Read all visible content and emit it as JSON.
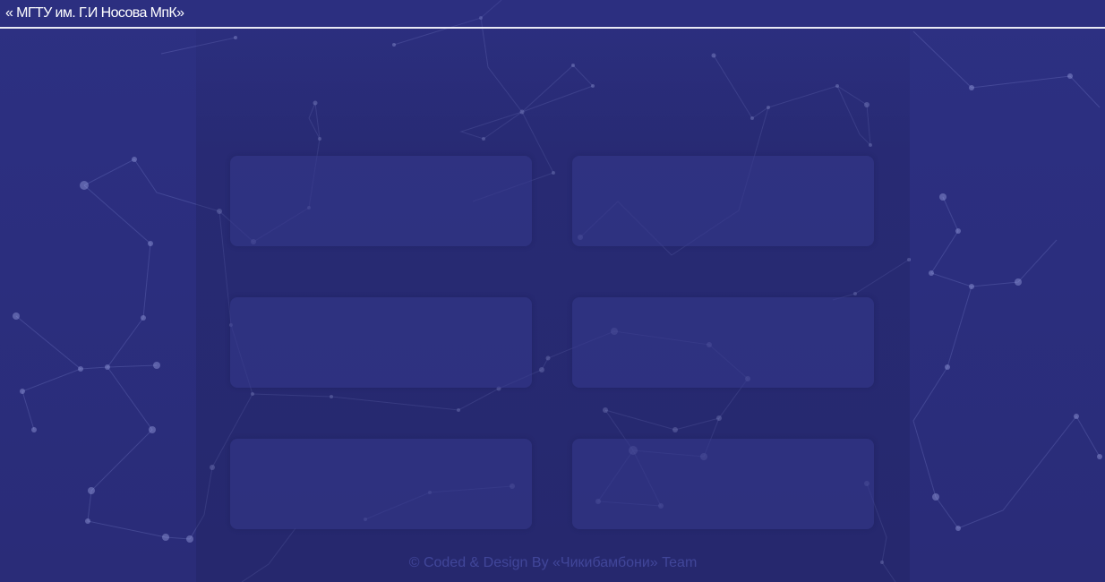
{
  "header": {
    "site_title": "« МГТУ им. Г.И Носова МпК»"
  },
  "main": {
    "cards": [
      {
        "label": ""
      },
      {
        "label": ""
      },
      {
        "label": ""
      },
      {
        "label": ""
      },
      {
        "label": ""
      },
      {
        "label": ""
      }
    ]
  },
  "footer": {
    "text": "© Coded & Design By «Чикибамбони» Team"
  },
  "colors": {
    "background": "#2d3082",
    "panel": "#232666",
    "card": "#34388c",
    "header_border": "#e9eaf5",
    "footer_text": "#585ebe"
  }
}
